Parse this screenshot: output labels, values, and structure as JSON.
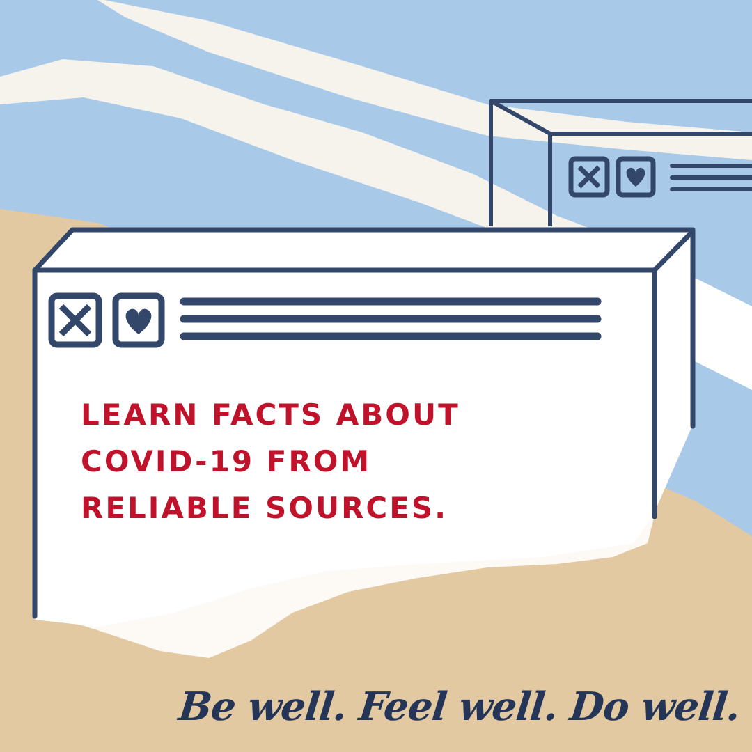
{
  "poster": {
    "headline": {
      "line1": "LEARN FACTS ABOUT",
      "line2": "COVID-19 FROM",
      "line3": "RELIABLE SOURCES."
    },
    "tagline": "Be well. Feel well. Do well.",
    "icons": {
      "close": "close-box-icon",
      "favorite": "heart-box-icon",
      "menu": "menu-lines-icon"
    },
    "colors": {
      "headline": "#c0132b",
      "outline": "#33476b",
      "sky": "#a9c9e8",
      "sand": "#e3c9a2",
      "paper": "#ffffff"
    }
  }
}
